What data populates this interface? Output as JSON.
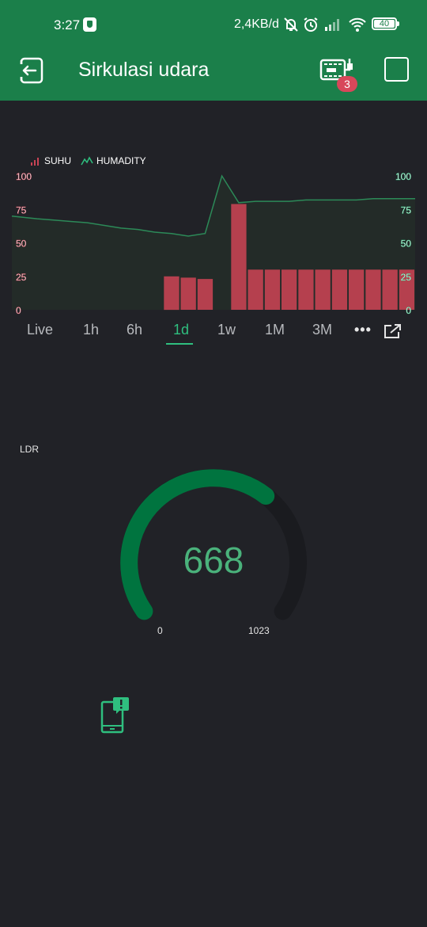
{
  "status_bar": {
    "time": "3:27",
    "network_speed": "2,4KB/d",
    "battery_level": "40",
    "icons": [
      "shield-icon",
      "mute-bell-icon",
      "alarm-icon",
      "signal-icon",
      "wifi-icon",
      "battery-icon"
    ]
  },
  "app_bar": {
    "title": "Sirkulasi udara",
    "device_badge_count": "3",
    "icons": [
      "exit-icon",
      "device-icon",
      "square-icon"
    ],
    "color": "#1b7f4a"
  },
  "chart_widget": {
    "legend": {
      "suhu": "SUHU",
      "humidity": "HUMADITY"
    },
    "time_tabs": [
      "Live",
      "1h",
      "6h",
      "1d",
      "1w",
      "1M",
      "3M"
    ],
    "active_tab": "1d",
    "more_label": "•••"
  },
  "chart_data": {
    "type": "bar",
    "series": [
      {
        "name": "SUHU",
        "type": "bar",
        "color": "#b5404e",
        "values": [
          null,
          null,
          null,
          null,
          null,
          null,
          null,
          null,
          null,
          25,
          24,
          23,
          null,
          79,
          30,
          30,
          30,
          30,
          30,
          30,
          30,
          30,
          30,
          30
        ]
      },
      {
        "name": "HUMADITY",
        "type": "line",
        "color": "#2c8a58",
        "values": [
          70,
          68,
          67,
          66,
          65,
          63,
          61,
          60,
          58,
          57,
          55,
          57,
          100,
          80,
          81,
          81,
          81,
          82,
          82,
          82,
          82,
          83,
          83,
          83
        ]
      }
    ],
    "y_ticks": [
      "0",
      "25",
      "50",
      "75",
      "100"
    ],
    "ylim": [
      0,
      100
    ]
  },
  "gauge_widget": {
    "label": "LDR",
    "value": "668",
    "min": "0",
    "max": "1023",
    "value_numeric": 668,
    "min_numeric": 0,
    "max_numeric": 1023,
    "color": "#00743f"
  },
  "notify_widget": {
    "icons": [
      "phone-notification-icon"
    ]
  }
}
